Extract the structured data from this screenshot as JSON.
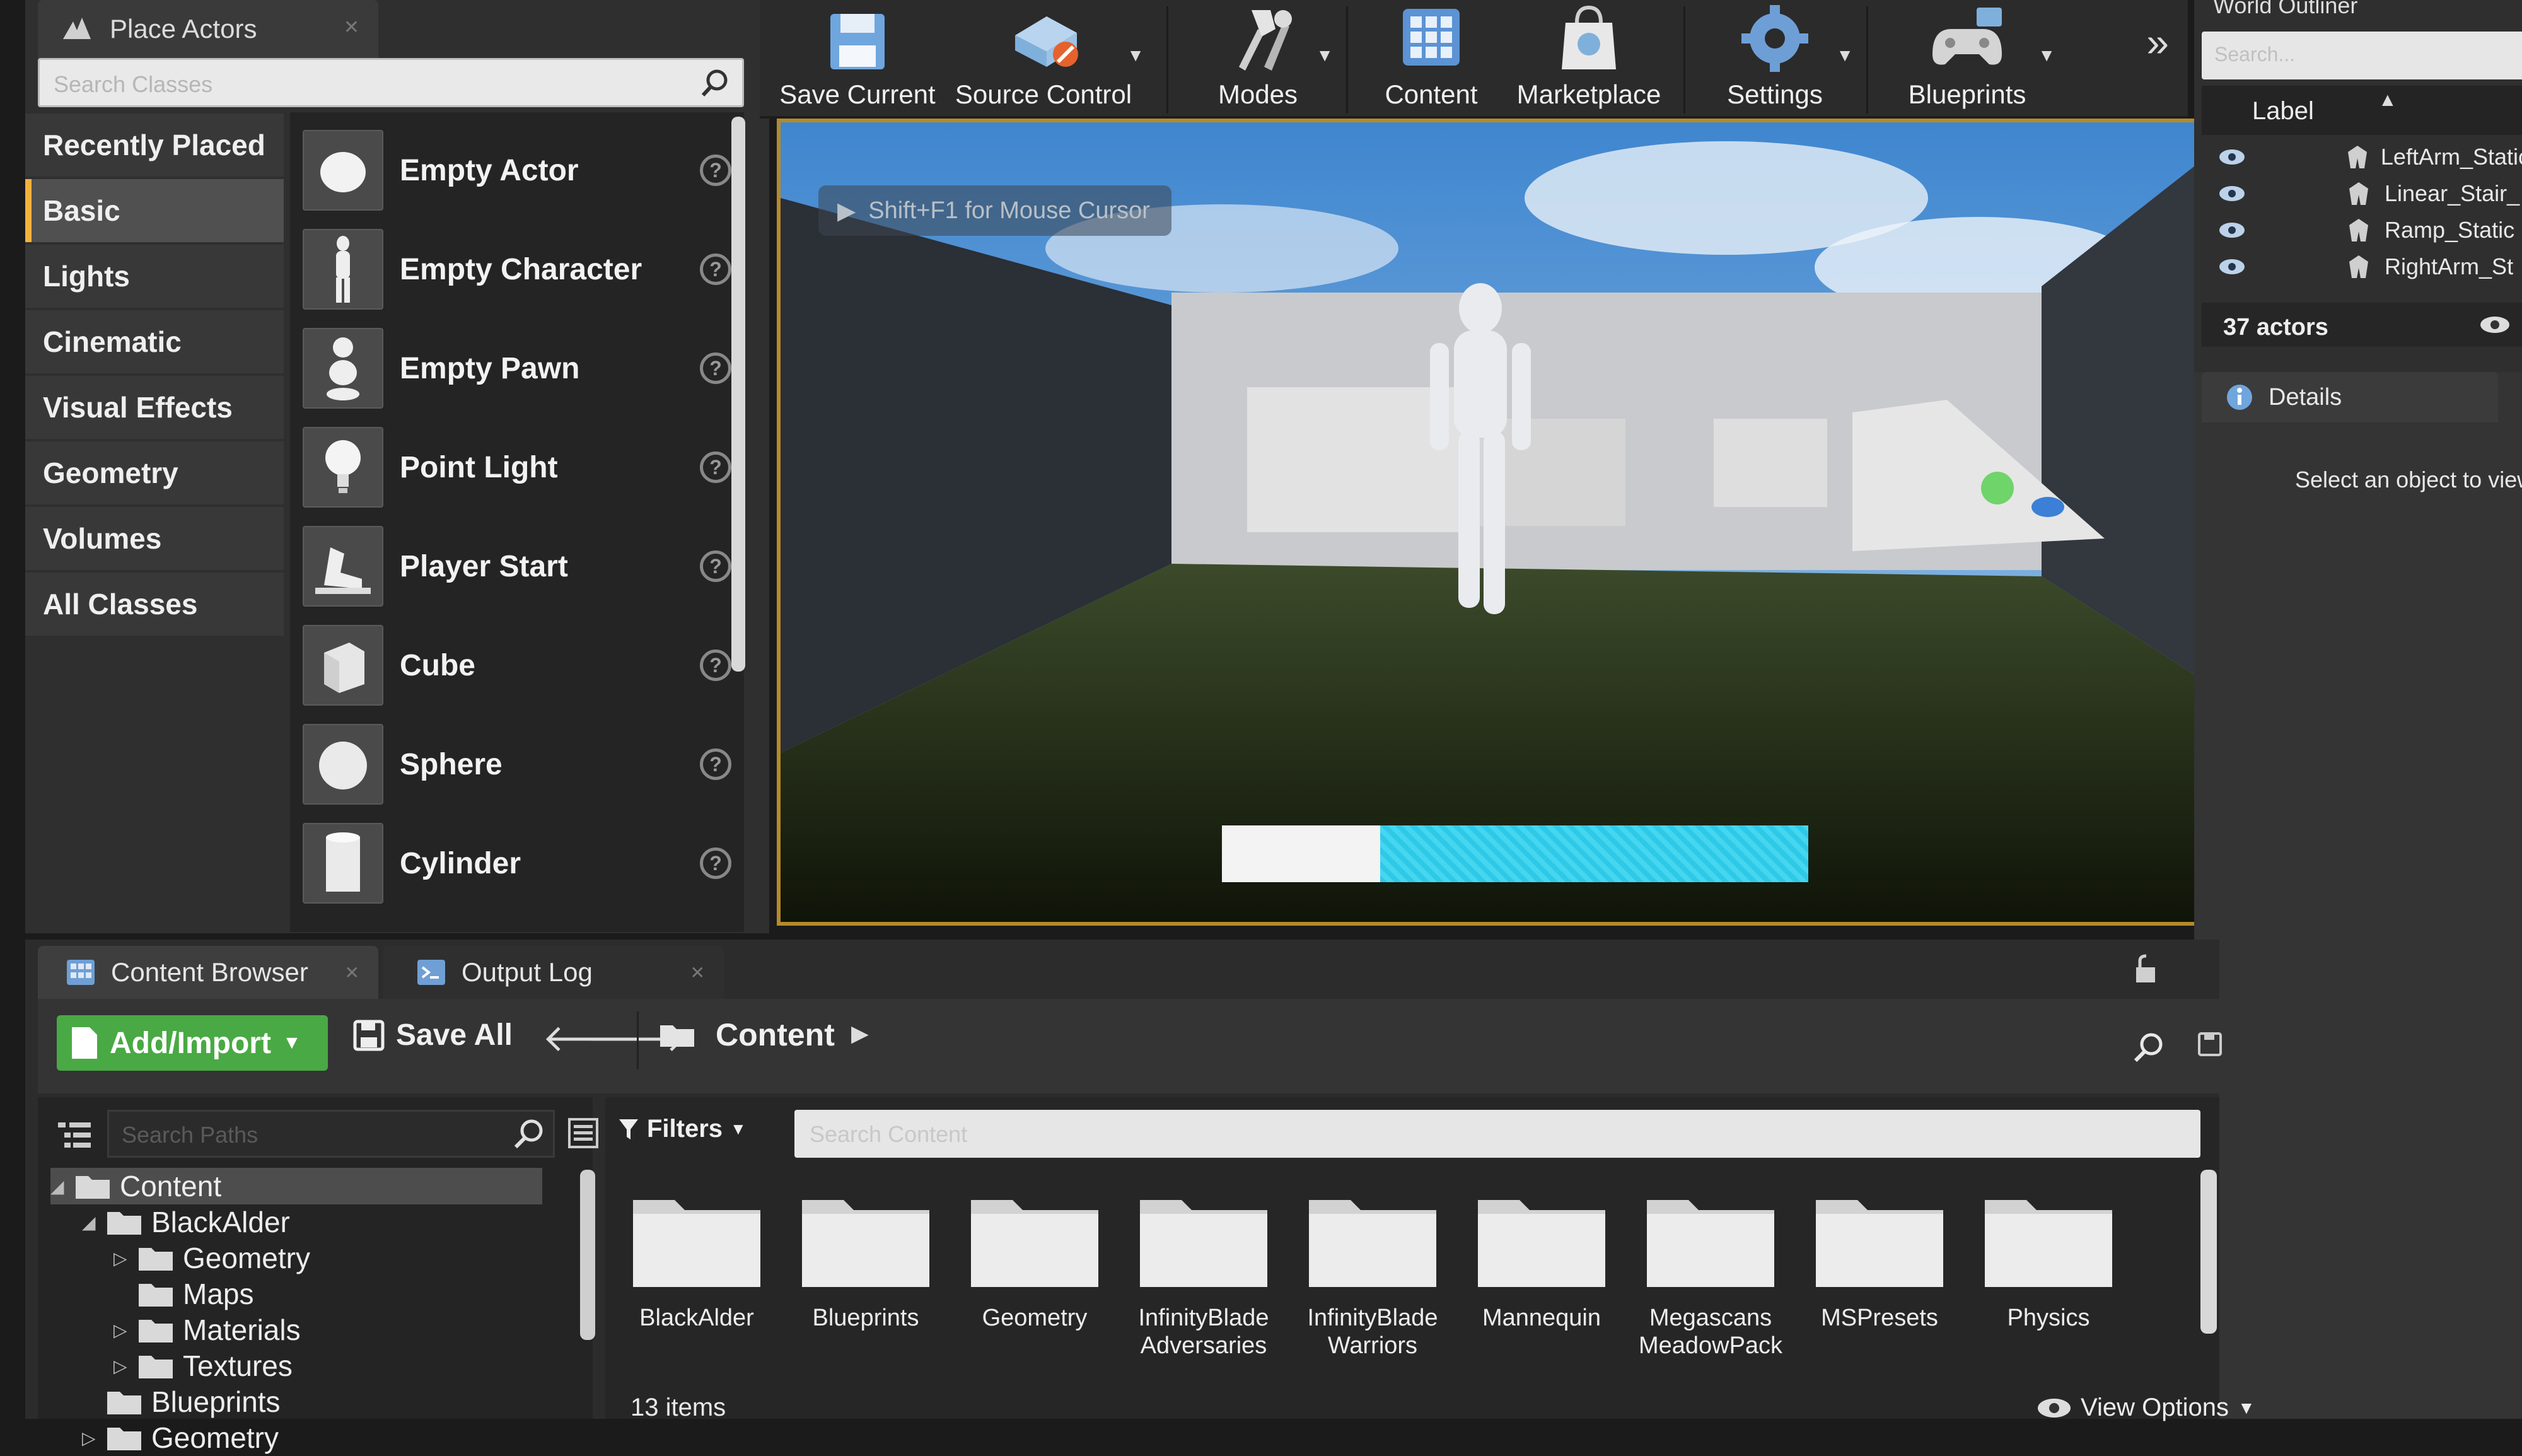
{
  "place_actors": {
    "tab_title": "Place Actors",
    "search_placeholder": "Search Classes",
    "categories": [
      "Recently Placed",
      "Basic",
      "Lights",
      "Cinematic",
      "Visual Effects",
      "Geometry",
      "Volumes",
      "All Classes"
    ],
    "active_category": "Basic",
    "actors": [
      {
        "name": "Empty Actor",
        "icon": "empty-actor-icon"
      },
      {
        "name": "Empty Character",
        "icon": "character-icon"
      },
      {
        "name": "Empty Pawn",
        "icon": "pawn-icon"
      },
      {
        "name": "Point Light",
        "icon": "point-light-icon"
      },
      {
        "name": "Player Start",
        "icon": "player-start-icon"
      },
      {
        "name": "Cube",
        "icon": "cube-icon"
      },
      {
        "name": "Sphere",
        "icon": "sphere-icon"
      },
      {
        "name": "Cylinder",
        "icon": "cylinder-icon"
      }
    ],
    "help_glyph": "?"
  },
  "toolbar": {
    "items": [
      {
        "label": "Save Current",
        "icon": "save-icon"
      },
      {
        "label": "Source Control",
        "icon": "source-control-icon"
      },
      {
        "label": "Modes",
        "icon": "modes-icon"
      },
      {
        "label": "Content",
        "icon": "content-icon"
      },
      {
        "label": "Marketplace",
        "icon": "marketplace-icon"
      },
      {
        "label": "Settings",
        "icon": "settings-icon"
      },
      {
        "label": "Blueprints",
        "icon": "blueprints-icon"
      }
    ],
    "more_glyph": "»"
  },
  "viewport": {
    "hint_text": "Shift+F1 for Mouse Cursor",
    "loading_progress": 0.73,
    "progress_color": "#2fc9e8",
    "border_color": "#b58a2a"
  },
  "world_outliner": {
    "title": "World Outliner",
    "search_placeholder": "Search...",
    "column_label": "Label",
    "rows": [
      "LeftArm_Static",
      "Linear_Stair_",
      "Ramp_Static",
      "RightArm_St"
    ],
    "actor_count": "37 actors"
  },
  "details": {
    "tab_title": "Details",
    "empty_message": "Select an object to view details."
  },
  "content_browser": {
    "tab_title": "Content Browser",
    "output_log_title": "Output Log",
    "add_import_label": "Add/Import",
    "save_all_label": "Save All",
    "breadcrumb": "Content",
    "search_paths_placeholder": "Search Paths",
    "search_content_placeholder": "Search Content",
    "filters_label": "Filters",
    "tree": [
      {
        "label": "Content",
        "level": 0,
        "expanded": true,
        "selected": true
      },
      {
        "label": "BlackAlder",
        "level": 1,
        "expanded": true
      },
      {
        "label": "Geometry",
        "level": 2,
        "expanded": false
      },
      {
        "label": "Maps",
        "level": 2,
        "leaf": true
      },
      {
        "label": "Materials",
        "level": 2,
        "expanded": false
      },
      {
        "label": "Textures",
        "level": 2,
        "expanded": false
      },
      {
        "label": "Blueprints",
        "level": 1,
        "leaf": true
      },
      {
        "label": "Geometry",
        "level": 1,
        "expanded": false
      }
    ],
    "folders": [
      "BlackAlder",
      "Blueprints",
      "Geometry",
      "InfinityBlade\nAdversaries",
      "InfinityBlade\nWarriors",
      "Mannequin",
      "Megascans\nMeadowPack",
      "MSPresets",
      "Physics"
    ],
    "view_options_label": "View Options",
    "item_count": "13 items",
    "accent_green": "#49a944"
  }
}
